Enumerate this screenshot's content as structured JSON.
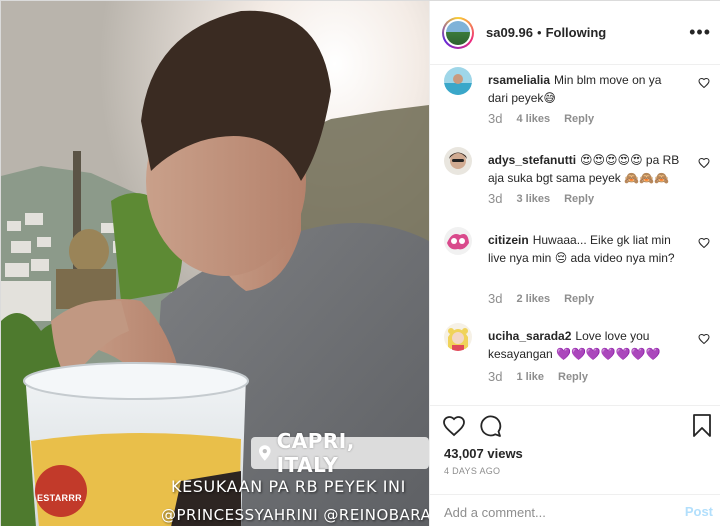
{
  "media": {
    "location_overlay": "CAPRI, ITALY",
    "caption_overlay": "KESUKAAN PA RB PEYEK INI",
    "tags_overlay": "@PRINCESSYAHRINI @REINOBARACK",
    "bucket_label": "ESTARRR"
  },
  "header": {
    "username": "sa09.96",
    "separator": "•",
    "follow_status": "Following",
    "more_icon": "more-horizontal-icon"
  },
  "comments": [
    {
      "username": "rsamelialia",
      "text": "Min blm move on ya dari peyek😅",
      "age": "3d",
      "likes": "4 likes",
      "reply": "Reply"
    },
    {
      "username": "adys_stefanutti",
      "text": "😍😍😍😍😍 pa RB aja suka bgt sama peyek 🙈🙈🙈",
      "age": "3d",
      "likes": "3 likes",
      "reply": "Reply"
    },
    {
      "username": "citizein",
      "text": "Huwaaa... Eike gk liat min live nya min 😔 ada video nya min?",
      "age": "3d",
      "likes": "2 likes",
      "reply": "Reply"
    },
    {
      "username": "uciha_sarada2",
      "text": "Love love you kesayangan 💜💜💜💜💜💜💜",
      "age": "3d",
      "likes": "1 like",
      "reply": "Reply"
    }
  ],
  "actions": {
    "views": "43,007 views",
    "posted_ago": "4 DAYS AGO",
    "comment_placeholder": "Add a comment...",
    "post_label": "Post"
  }
}
